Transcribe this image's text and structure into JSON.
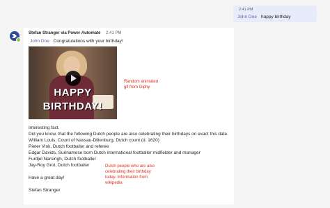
{
  "sent_message": {
    "time": "2:41 PM",
    "mention": "John Doe",
    "text": "happy birthday"
  },
  "received_message": {
    "sender": "Stefan Stranger via Power Automate",
    "time": "2:41 PM",
    "mention": "John Doe",
    "greeting": "Congratulations with your birthday!",
    "gif_caption_line1": "HAPPY",
    "gif_caption_line2": "BIRTHDAY!",
    "annotation_gif_line1": "Random animated",
    "annotation_gif_line2": "gif from Giphy",
    "lines": [
      "Interesting fact.",
      "Did you know, that the following Dutch people are also celebrating their birthdays on exact this date.",
      "William Louis, Count of Nassau-Dillenburg, Dutch count (d. 1620)",
      "Pieter Vink, Dutch footballer and referee",
      "Edgar Davids, Surinamese born Dutch international footballer midfielder and manager",
      "Furdjel Narsingh, Dutch footballer",
      "Jay-Roy Grot, Dutch footballer"
    ],
    "closing": "Have a great day!",
    "signature": "Stefan Stranger",
    "annotation_dutch_line1": "Dutch people who are also",
    "annotation_dutch_line2": "celebrating their birthday",
    "annotation_dutch_line3": "today.  Information from",
    "annotation_dutch_line4": "wikipedia"
  },
  "colors": {
    "accent": "#6264a7",
    "annotation": "#e0301e",
    "avatar": "#2d4b96",
    "presence": "#92c353"
  }
}
